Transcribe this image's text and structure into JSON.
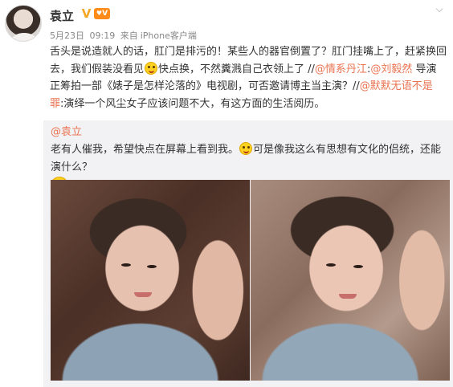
{
  "post": {
    "author": "袁立",
    "verified_icon": "v-badge-icon",
    "level_badge": "V",
    "meta": {
      "date": "5月23日",
      "time": "09:19",
      "source_prefix": "来自",
      "source": "iPhone客户端"
    },
    "text": {
      "part1": "舌头是说造就人的话，肛门是排污的！某些人的器官倒置了？肛门挂嘴上了，赶紧换回去，我们假装没看见",
      "part2": "快点换，不然糞溅自己衣领上了 //",
      "mention1": "@情系丹江",
      "sep1": ":",
      "mention2": "@刘毅然",
      "part3": " 导演正筹拍一部《婊子是怎样沦落的》电视剧，可否邀请博主当主演？//",
      "mention3": "@默默无语不是罪",
      "part4": ":演绎一个风尘女子应该问题不大，有这方面的生活阅历。"
    },
    "colors": {
      "link": "#eb7350",
      "repost_bg": "#f2f2f5",
      "badge": "#ff8c1a"
    }
  },
  "repost": {
    "author": "@袁立",
    "text1": "老有人催我，希望快点在屏幕上看到我。",
    "text2": "可是像我这么有思想有文化的侣统，还能演什么？",
    "photos": [
      "selfie-photo-1",
      "selfie-photo-2"
    ]
  }
}
